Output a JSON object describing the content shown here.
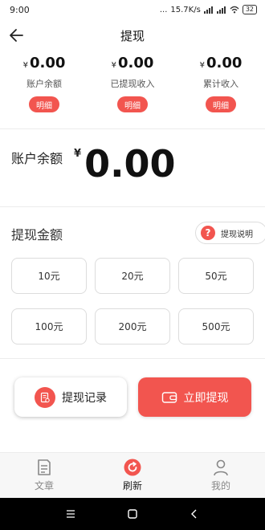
{
  "status_bar": {
    "time": "9:00",
    "dots": "...",
    "speed": "15.7K/s",
    "battery": "32"
  },
  "header": {
    "title": "提现",
    "back_icon": "arrow-left-icon"
  },
  "stats": [
    {
      "currency": "¥",
      "amount": "0.00",
      "label": "账户余额",
      "button": "明细"
    },
    {
      "currency": "¥",
      "amount": "0.00",
      "label": "已提现收入",
      "button": "明细"
    },
    {
      "currency": "¥",
      "amount": "0.00",
      "label": "累计收入",
      "button": "明细"
    }
  ],
  "balance": {
    "label": "账户余额",
    "currency": "¥",
    "amount": "0.00"
  },
  "withdraw": {
    "title": "提现金额",
    "help_label": "提现说明",
    "help_icon_text": "?",
    "amounts": [
      "10元",
      "20元",
      "50元",
      "100元",
      "200元",
      "500元"
    ]
  },
  "actions": {
    "record_label": "提现记录",
    "withdraw_label": "立即提现"
  },
  "tabs": [
    {
      "label": "文章",
      "icon": "document-icon",
      "active": false
    },
    {
      "label": "刷新",
      "icon": "refresh-icon",
      "active": true
    },
    {
      "label": "我的",
      "icon": "user-icon",
      "active": false
    }
  ],
  "colors": {
    "accent": "#f2554f",
    "text": "#222222",
    "tab_inactive": "#888888"
  }
}
